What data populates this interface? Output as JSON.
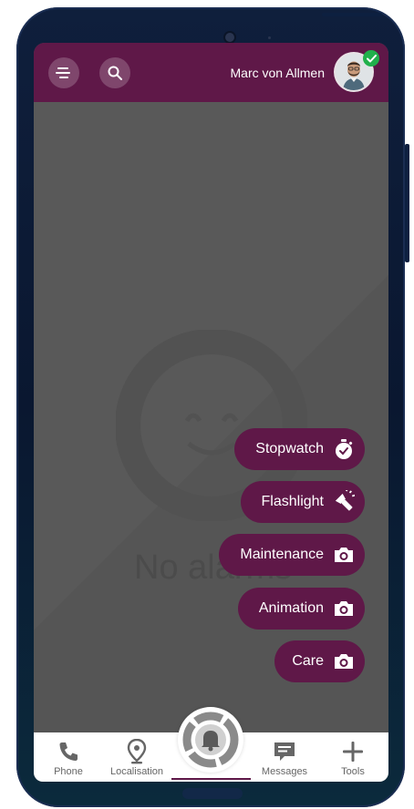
{
  "header": {
    "user_name": "Marc von Allmen",
    "menu_icon": "menu-icon",
    "search_icon": "search-icon",
    "status": "online"
  },
  "main": {
    "empty_state_text": "No alarms"
  },
  "quick_actions": [
    {
      "label": "Stopwatch",
      "icon": "stopwatch-icon"
    },
    {
      "label": "Flashlight",
      "icon": "flashlight-icon"
    },
    {
      "label": "Maintenance",
      "icon": "camera-icon"
    },
    {
      "label": "Animation",
      "icon": "camera-icon"
    },
    {
      "label": "Care",
      "icon": "camera-icon"
    }
  ],
  "bottom_nav": {
    "items": [
      {
        "label": "Phone",
        "icon": "phone-icon"
      },
      {
        "label": "Localisation",
        "icon": "location-pin-icon"
      },
      {
        "label": "",
        "icon": "alarm-bell-icon"
      },
      {
        "label": "Messages",
        "icon": "message-icon"
      },
      {
        "label": "Tools",
        "icon": "plus-icon"
      }
    ]
  },
  "colors": {
    "brand": "#5f1848",
    "content_bg": "#595959",
    "status_online": "#20b04b"
  }
}
